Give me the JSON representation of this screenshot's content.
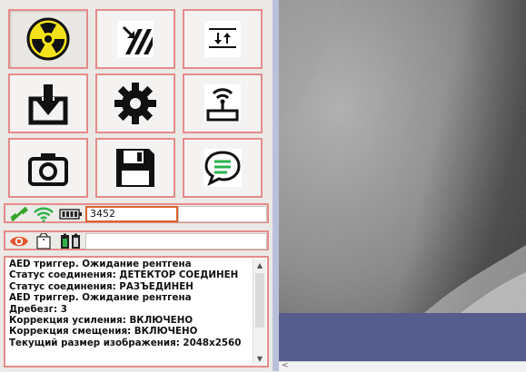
{
  "toolbar": {
    "buttons": [
      {
        "id": "radiation",
        "icon": "radiation-icon"
      },
      {
        "id": "exposure",
        "icon": "exposure-arrows-icon"
      },
      {
        "id": "adjust",
        "icon": "up-down-adjust-icon"
      },
      {
        "id": "download",
        "icon": "download-tray-icon"
      },
      {
        "id": "settings",
        "icon": "gear-icon"
      },
      {
        "id": "wireless-device",
        "icon": "wireless-device-icon"
      },
      {
        "id": "capture",
        "icon": "camera-icon"
      },
      {
        "id": "save",
        "icon": "floppy-disk-icon"
      },
      {
        "id": "messages",
        "icon": "chat-bubble-icon"
      }
    ]
  },
  "status": {
    "icons_row1": [
      "link-icon",
      "wifi-icon",
      "battery-icon"
    ],
    "counter_value": "3452",
    "secondary_value": "",
    "icons_row2": [
      "eye-icon",
      "detector-icon",
      "dual-battery-icon"
    ],
    "row2_value": ""
  },
  "log": {
    "lines": [
      "AED триггер. Ожидание рентгена",
      "Статус соединения: ДЕТЕКТОР СОЕДИНЕН",
      "Статус соединения: РАЗЪЕДИНЕН",
      "AED триггер. Ожидание рентгена",
      "Дребезг: 3",
      "Коррекция усиления: ВКЛЮЧЕНО",
      "Коррекция смещения: ВКЛЮЧЕНО",
      "Текущий размер изображения: 2048x2560"
    ]
  },
  "colors": {
    "panel_border": "#e58b8b",
    "active_field_border": "#d9632e",
    "splitter": "#b9c0d9",
    "blank_area": "#565c8c"
  }
}
